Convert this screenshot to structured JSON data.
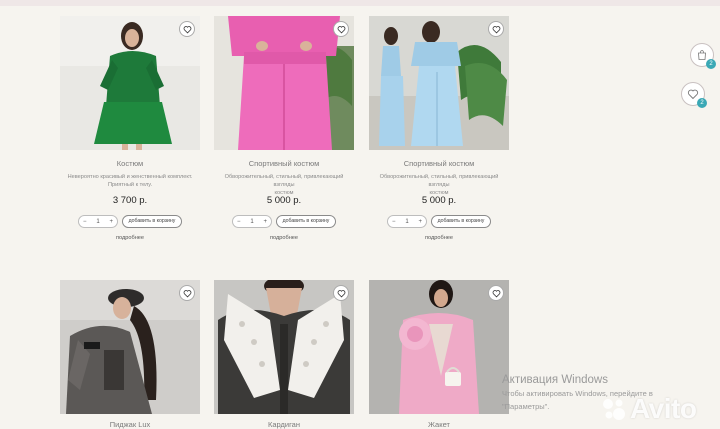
{
  "products_row1": [
    {
      "name": "Костюм",
      "description_lines": [
        "Невероятно красивый и женственный комплект.",
        "Приятный к телу."
      ],
      "price": "3 700 р.",
      "qty": "1",
      "add_to_cart": "добавить в корзину",
      "more": "подробнее"
    },
    {
      "name": "Спортивный костюм",
      "description_lines": [
        "Обворожительный, стильный, привлекающий взгляды",
        "костюм"
      ],
      "price": "5 000 р.",
      "qty": "1",
      "add_to_cart": "добавить в корзину",
      "more": "подробнее"
    },
    {
      "name": "Спортивный костюм",
      "description_lines": [
        "Обворожительный, стильный, привлекающий взгляды",
        "костюм"
      ],
      "price": "5 000 р.",
      "qty": "1",
      "add_to_cart": "добавить в корзину",
      "more": "подробнее"
    }
  ],
  "products_row2_names": [
    "Пиджак Lux",
    "Кардиган",
    "Жакет"
  ],
  "stepper": {
    "minus": "−",
    "plus": "+"
  },
  "floating": {
    "cart_badge": "2",
    "wishlist_badge": "2",
    "cart_icon": "shopping-bag-icon",
    "wishlist_icon": "heart-icon"
  },
  "watermark": {
    "title": "Активация Windows",
    "line1": "Чтобы активировать Windows, перейдите в",
    "line2": "\"Параметры\"."
  },
  "avito_logo": "Avito",
  "colors": {
    "background": "#f6f4ef",
    "badge": "#3aa8b5"
  }
}
